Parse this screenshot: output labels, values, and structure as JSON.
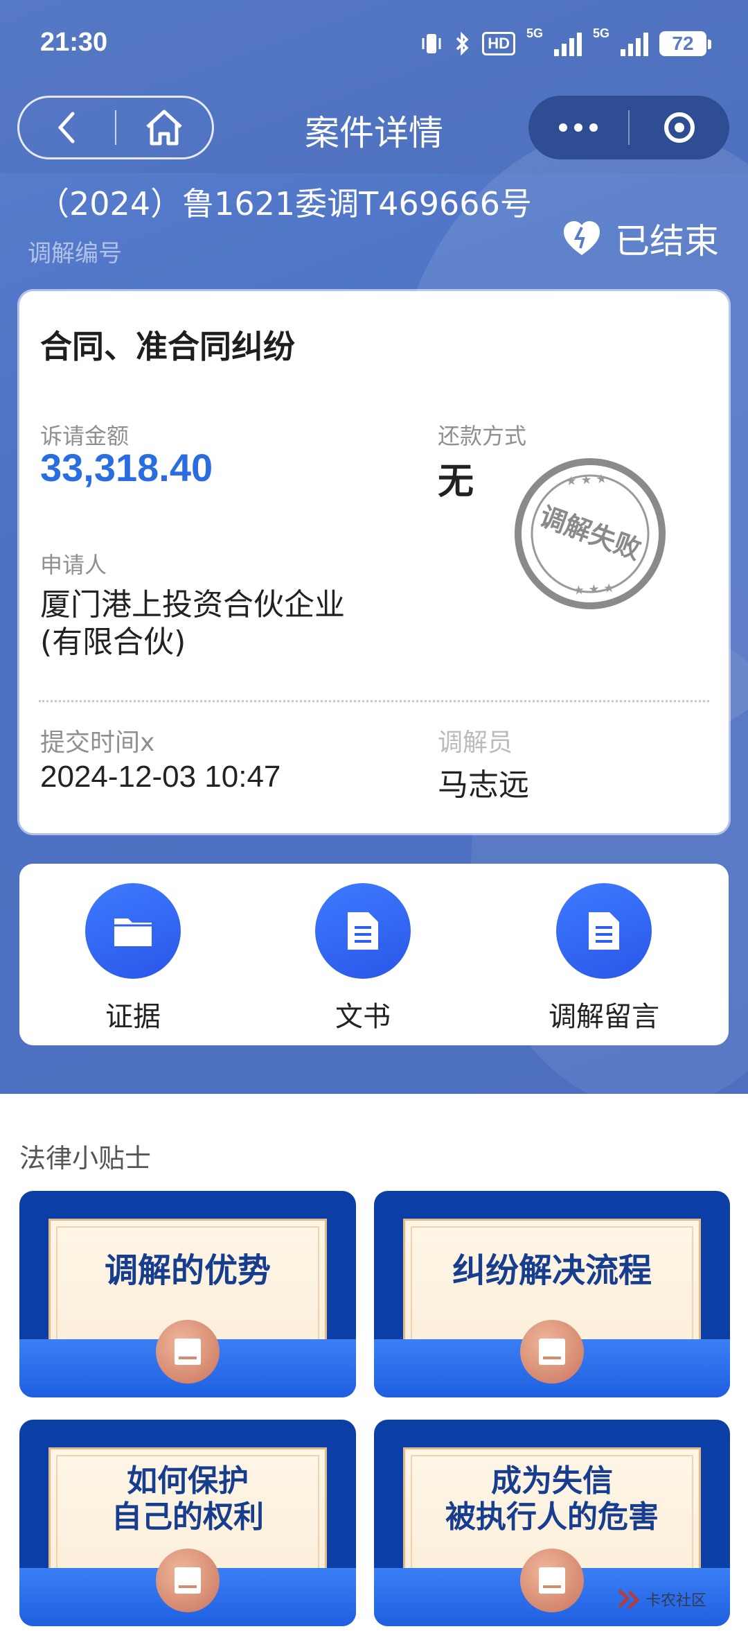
{
  "status_bar": {
    "time": "21:30",
    "hd_label": "HD",
    "network_1": "5G",
    "network_2": "5G",
    "battery": "72"
  },
  "nav": {
    "title": "案件详情"
  },
  "case": {
    "number": "（2024）鲁1621委调T469666号",
    "number_label": "调解编号",
    "status": "已结束",
    "type": "合同、准合同纠纷",
    "claim_amount_label": "诉请金额",
    "claim_amount": "33,318.40",
    "repayment_label": "还款方式",
    "repayment": "无",
    "stamp_text": "调解失败",
    "applicant_label": "申请人",
    "applicant_line1": "厦门港上投资合伙企业",
    "applicant_line2": "(有限合伙)",
    "submit_time_label": "提交时间x",
    "submit_time": "2024-12-03 10:47",
    "mediator_label": "调解员",
    "mediator": "马志远"
  },
  "actions": [
    {
      "label": "证据",
      "icon": "folder-icon"
    },
    {
      "label": "文书",
      "icon": "document-icon"
    },
    {
      "label": "调解留言",
      "icon": "document-icon"
    }
  ],
  "tips": {
    "title": "法律小贴士",
    "items": [
      {
        "line1": "调解的优势",
        "line2": ""
      },
      {
        "line1": "纠纷解决流程",
        "line2": ""
      },
      {
        "line1": "如何保护",
        "line2": "自己的权利"
      },
      {
        "line1": "成为失信",
        "line2": "被执行人的危害"
      }
    ]
  },
  "watermark": "卡农社区",
  "colors": {
    "accent_blue": "#2a6de0",
    "hero_blue": "#4d72c4",
    "action_blue": "#2a56e8",
    "tip_navy": "#0b3fa5"
  }
}
